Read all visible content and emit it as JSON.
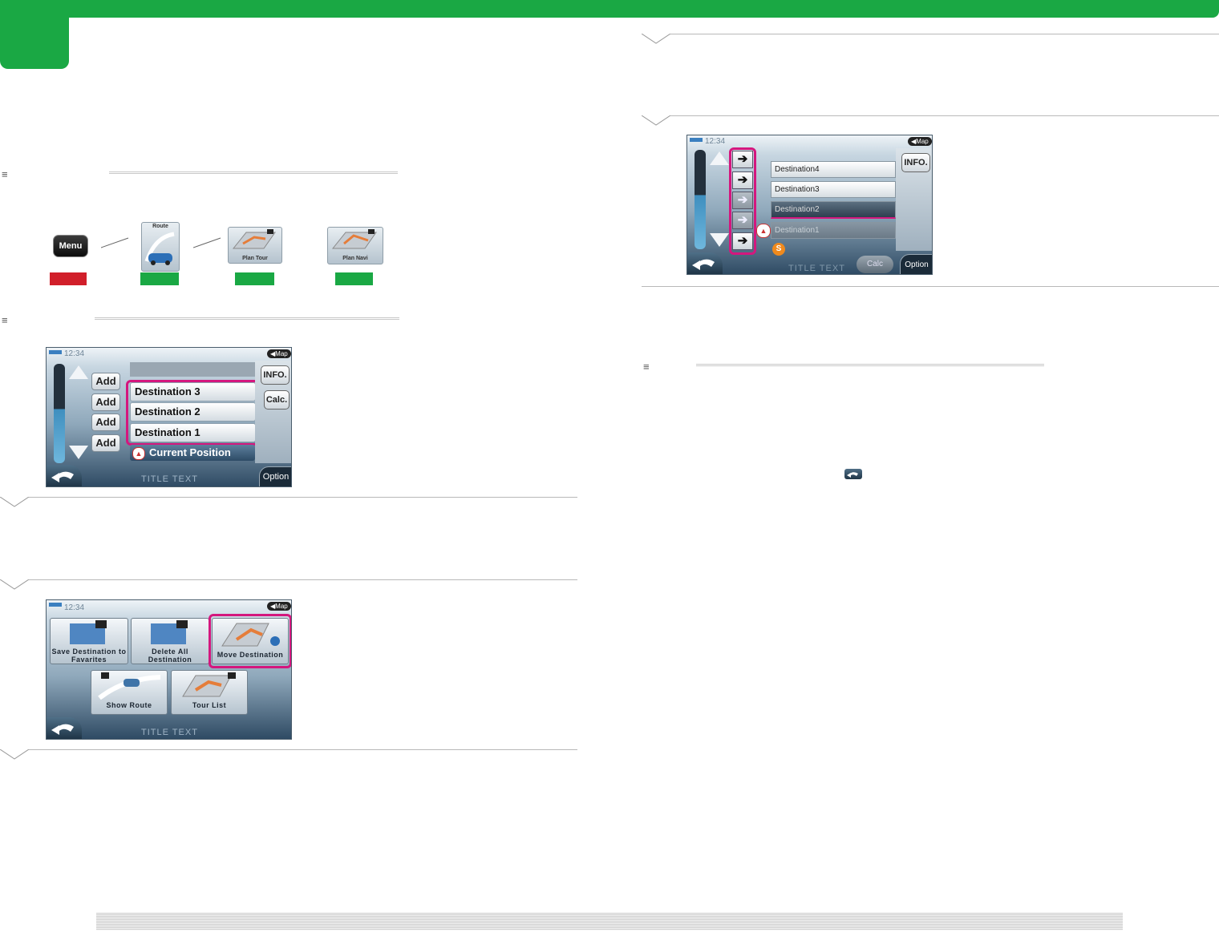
{
  "colors": {
    "brand_green": "#1aa844",
    "label_red": "#d11f2a",
    "highlight_pink": "#d4177e"
  },
  "flow": {
    "menu_button": "Menu",
    "route_label": "Route",
    "plan_tour_label": "Plan Tour",
    "plan_navi_label": "Plan Navi"
  },
  "screen1": {
    "clock": "12:34",
    "map_button": "Map",
    "add_buttons": [
      "Add",
      "Add",
      "Add",
      "Add"
    ],
    "destinations": [
      "Destination 3",
      "Destination 2",
      "Destination 1"
    ],
    "current_position": "Current Position",
    "info_button": "INFO.",
    "calc_button": "Calc.",
    "title_text": "TITLE TEXT",
    "option_button": "Option"
  },
  "screen2": {
    "clock": "12:34",
    "map_button": "Map",
    "tiles": {
      "save_destination": "Save Destination to Favarites",
      "delete_all": "Delete All Destination",
      "move_destination": "Move Destination",
      "show_route": "Show Route",
      "tour_list": "Tour List"
    },
    "title_text": "TITLE TEXT"
  },
  "screen3": {
    "clock": "12:34",
    "map_button": "Map",
    "destinations": [
      "Destination4",
      "Destination3",
      "Destination2",
      "Destination1"
    ],
    "info_button": "INFO.",
    "start_badge": "S",
    "title_text": "TITLE TEXT",
    "calc_button": "Calc",
    "option_button": "Option"
  }
}
